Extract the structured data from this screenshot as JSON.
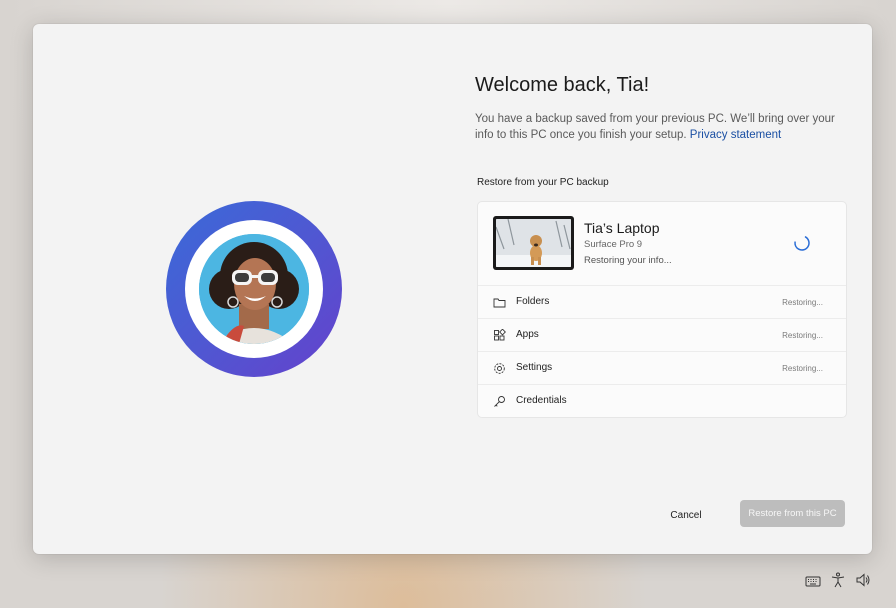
{
  "welcome": {
    "title": "Welcome back, Tia!",
    "description": "You have a backup saved from your previous PC. We’ll bring over your info to this PC once you finish your setup.",
    "privacy_link": "Privacy statement"
  },
  "backup": {
    "section_label": "Restore from your PC backup",
    "device": {
      "name": "Tia’s Laptop",
      "model": "Surface Pro 9",
      "status": "Restoring your info..."
    },
    "items": [
      {
        "label": "Folders",
        "status": "Restoring...",
        "icon": "folder-icon"
      },
      {
        "label": "Apps",
        "status": "Restoring...",
        "icon": "apps-icon"
      },
      {
        "label": "Settings",
        "status": "Restoring...",
        "icon": "gear-icon"
      },
      {
        "label": "Credentials",
        "status": "",
        "icon": "key-icon"
      }
    ]
  },
  "actions": {
    "cancel_label": "Cancel",
    "restore_label": "Restore from this PC"
  },
  "tray": {
    "icons": [
      "keyboard-icon",
      "accessibility-icon",
      "volume-icon"
    ]
  },
  "colors": {
    "ring_start": "#3a6ad8",
    "ring_end": "#6541cc",
    "link": "#1a4fa3",
    "spinner": "#2a6dd6",
    "disabled_button": "#bdbdbd"
  }
}
